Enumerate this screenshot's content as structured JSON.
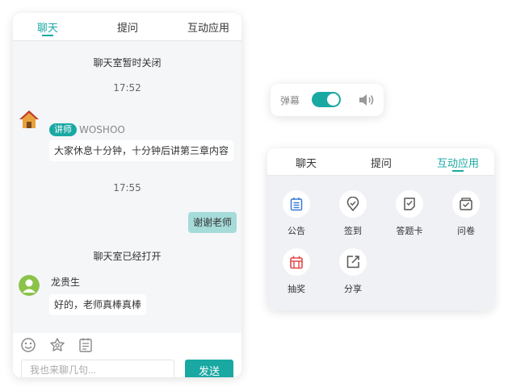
{
  "chat": {
    "tabs": [
      "聊天",
      "提问",
      "互动应用"
    ],
    "system_closed": "聊天室暂时关闭",
    "time1": "17:52",
    "teacher": {
      "badge": "讲师",
      "name": "WOSHOO",
      "message": "大家休息十分钟，十分钟后讲第三章内容"
    },
    "time2": "17:55",
    "my_message": "谢谢老师",
    "system_opened": "聊天室已经打开",
    "user": {
      "name": "龙贵生",
      "message": "好的，老师真棒真棒"
    },
    "toolbar_icons": [
      "emoji-icon",
      "flower-icon",
      "notes-icon"
    ],
    "input_placeholder": "我也来聊几句...",
    "send_label": "发送"
  },
  "danmu": {
    "label": "弹幕",
    "enabled": true,
    "icon": "speaker-icon"
  },
  "apps": {
    "tabs": [
      "聊天",
      "提问",
      "互动应用"
    ],
    "items": [
      {
        "label": "公告",
        "icon": "notice-icon",
        "color": "#3a7bd5"
      },
      {
        "label": "签到",
        "icon": "checkin-icon",
        "color": "#555555"
      },
      {
        "label": "答题卡",
        "icon": "answer-card-icon",
        "color": "#555555"
      },
      {
        "label": "问卷",
        "icon": "survey-icon",
        "color": "#555555"
      },
      {
        "label": "抽奖",
        "icon": "lottery-icon",
        "color": "#e04848"
      },
      {
        "label": "分享",
        "icon": "share-icon",
        "color": "#555555"
      }
    ]
  },
  "colors": {
    "accent": "#1aa8a3",
    "my_bubble": "#a5dbd9",
    "lottery": "#e04848",
    "notice": "#3a7bd5"
  }
}
